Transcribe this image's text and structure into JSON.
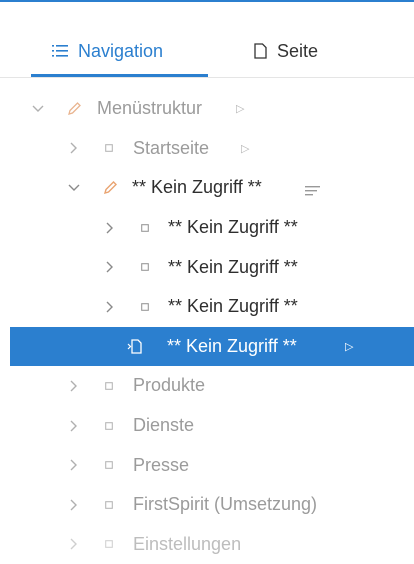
{
  "tabs": {
    "navigation": "Navigation",
    "page": "Seite"
  },
  "tree": {
    "root": "Menüstruktur",
    "startseite": "Startseite",
    "restricted_parent": "** Kein Zugriff **",
    "restricted_child_1": "** Kein Zugriff **",
    "restricted_child_2": "** Kein Zugriff **",
    "restricted_child_3": "** Kein Zugriff **",
    "restricted_selected": "** Kein Zugriff **",
    "produkte": "Produkte",
    "dienste": "Dienste",
    "presse": "Presse",
    "firstspirit": "FirstSpirit (Umsetzung)",
    "einstellungen": "Einstellungen"
  },
  "colors": {
    "accent": "#2b7fcf",
    "muted_text": "#9b9b9b",
    "dark_text": "#2e2e2e"
  }
}
